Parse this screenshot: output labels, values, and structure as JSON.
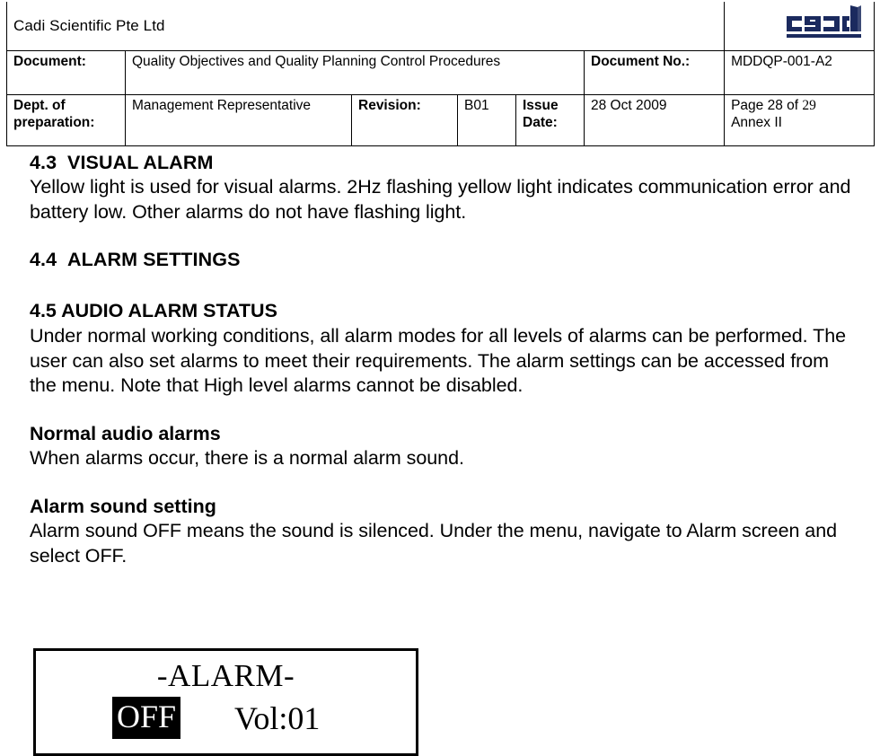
{
  "header": {
    "company": "Cadi Scientific Pte Ltd",
    "logo_alt": "cadi-logo",
    "logo_color": "#1b2a5e",
    "rows": [
      {
        "label": "Document:",
        "value": "Quality Objectives and Quality Planning Control Procedures",
        "label2": "Document No.:",
        "value2": "MDDQP-001-A2"
      }
    ],
    "dept_label": "Dept. of preparation:",
    "dept_value": "Management Representative",
    "revision_label": "Revision:",
    "revision_value": "B01",
    "issue_date_label": "Issue Date:",
    "issue_date_value": "28 Oct 2009",
    "page_prefix": "Page 28 of ",
    "page_total": "29",
    "annex": "Annex II"
  },
  "body": {
    "s43": {
      "number": "4.3",
      "title": "VISUAL ALARM",
      "text": "Yellow light is used for visual alarms. 2Hz flashing yellow light indicates communication error and battery low. Other alarms do not have flashing light."
    },
    "s44": {
      "number": "4.4",
      "title": "ALARM SETTINGS"
    },
    "s45": {
      "title": "4.5 AUDIO ALARM STATUS",
      "text": "Under normal working conditions, all alarm modes for all levels of alarms can be performed. The user can also set alarms to meet their requirements. The alarm settings can be accessed from the menu. Note that High level alarms cannot be disabled."
    },
    "normal_alarms": {
      "title": "Normal audio alarms",
      "text": "When alarms occur, there is a normal alarm sound."
    },
    "sound_setting": {
      "title": "Alarm sound setting",
      "text": "Alarm sound OFF means the sound is silenced. Under the menu, navigate to Alarm screen and select OFF."
    }
  },
  "lcd": {
    "title": "-ALARM-",
    "selected_option": "OFF",
    "volume": "Vol:01"
  }
}
